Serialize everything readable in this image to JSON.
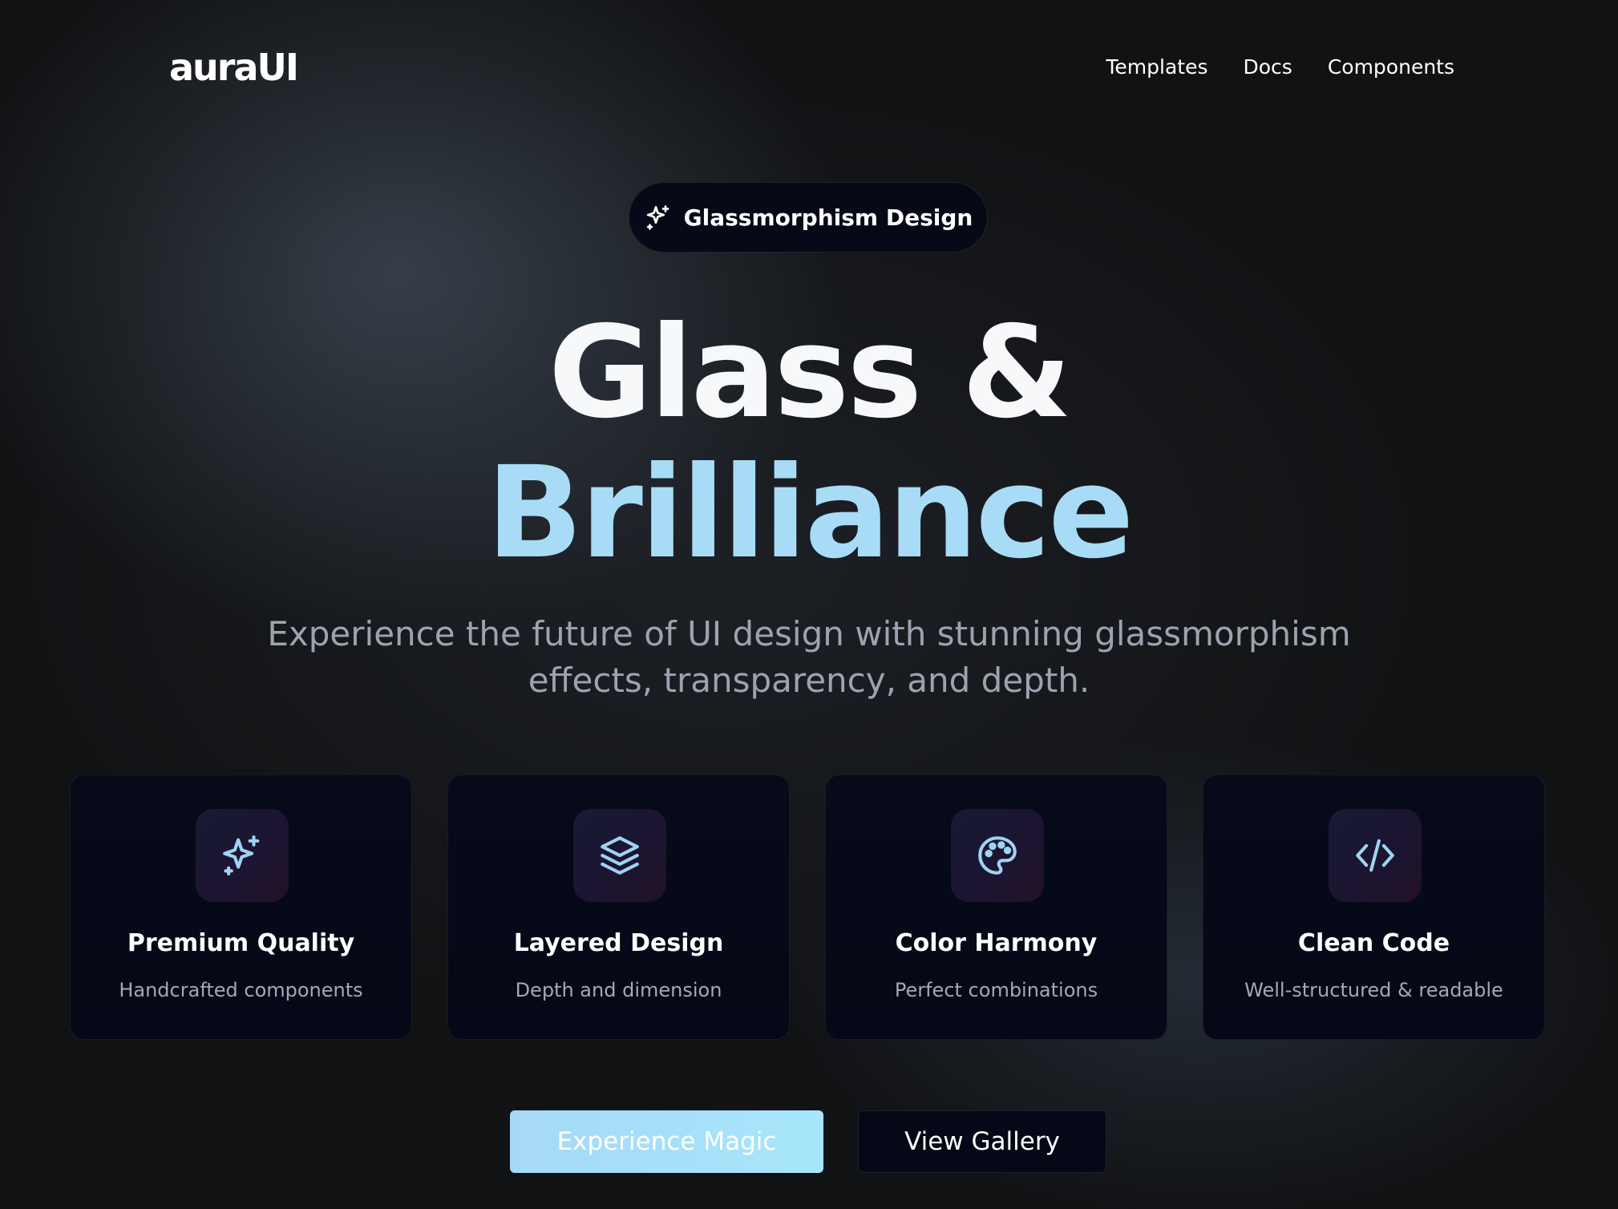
{
  "header": {
    "logo": "auraUI",
    "nav": [
      "Templates",
      "Docs",
      "Components"
    ]
  },
  "badge": {
    "label": "Glassmorphism Design",
    "icon": "sparkles-icon"
  },
  "hero": {
    "line1": "Glass &",
    "line2": "Brilliance",
    "subtitle_line1": "Experience the future of UI design with stunning glassmorphism",
    "subtitle_line2": "effects, transparency, and depth."
  },
  "features": [
    {
      "icon": "sparkles-icon",
      "title": "Premium Quality",
      "desc": "Handcrafted components"
    },
    {
      "icon": "layers-icon",
      "title": "Layered Design",
      "desc": "Depth and dimension"
    },
    {
      "icon": "palette-icon",
      "title": "Color Harmony",
      "desc": "Perfect combinations"
    },
    {
      "icon": "code-icon",
      "title": "Clean Code",
      "desc": "Well-structured & readable"
    }
  ],
  "actions": {
    "primary": "Experience Magic",
    "secondary": "View Gallery"
  },
  "colors": {
    "background": "#111214",
    "accent": "#a8dcf6",
    "card": "#060918",
    "muted_text": "#9ca3b0"
  }
}
